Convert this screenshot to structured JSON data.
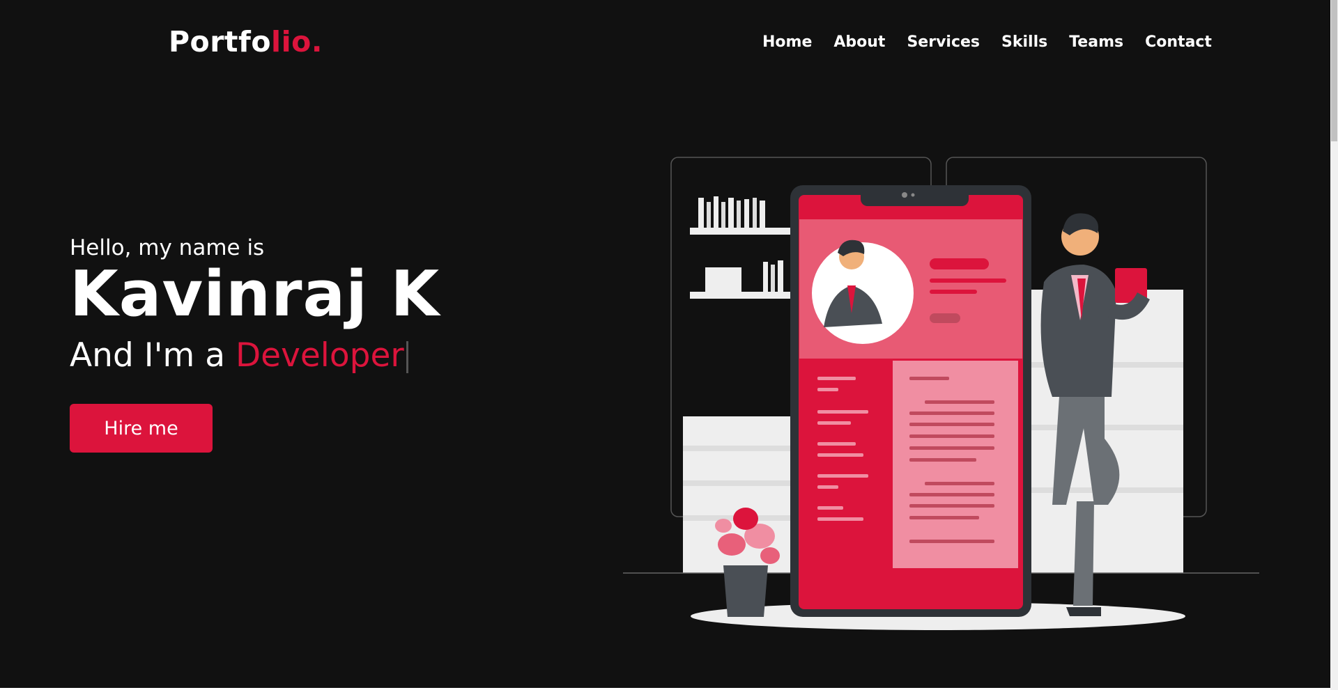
{
  "header": {
    "logo_main": "Portfo",
    "logo_accent": "lio."
  },
  "nav": {
    "items": [
      "Home",
      "About",
      "Services",
      "Skills",
      "Teams",
      "Contact"
    ]
  },
  "hero": {
    "greeting": "Hello, my name is",
    "name": "Kavinraj K",
    "role_prefix": "And I'm a ",
    "role_highlight": "Developer",
    "cta_label": "Hire me"
  },
  "colors": {
    "background": "#111111",
    "accent": "#dc143c",
    "text": "#ffffff"
  },
  "illustration": {
    "icon": "resume-portfolio-illustration"
  }
}
